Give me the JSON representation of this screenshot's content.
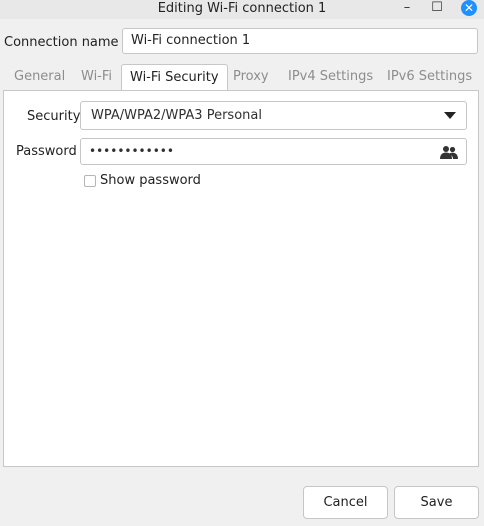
{
  "window": {
    "title": "Editing Wi-Fi connection 1",
    "minimize_glyph": "–",
    "maximize_glyph": "☐",
    "close_glyph": "✕"
  },
  "connection": {
    "label": "Connection name",
    "value": "Wi-Fi connection 1"
  },
  "tabs": [
    {
      "label": "General",
      "active": false
    },
    {
      "label": "Wi-Fi",
      "active": false
    },
    {
      "label": "Wi-Fi Security",
      "active": true
    },
    {
      "label": "Proxy",
      "active": false
    },
    {
      "label": "IPv4 Settings",
      "active": false
    },
    {
      "label": "IPv6 Settings",
      "active": false
    }
  ],
  "security": {
    "label": "Security",
    "value": "WPA/WPA2/WPA3 Personal"
  },
  "password": {
    "label": "Password",
    "value": "••••••••••••",
    "icon": "users-icon"
  },
  "show_password": {
    "label": "Show password",
    "checked": false
  },
  "buttons": {
    "cancel": "Cancel",
    "save": "Save"
  },
  "colors": {
    "accent": "#1e90ff",
    "inactive_tab": "#8d8d8d"
  }
}
